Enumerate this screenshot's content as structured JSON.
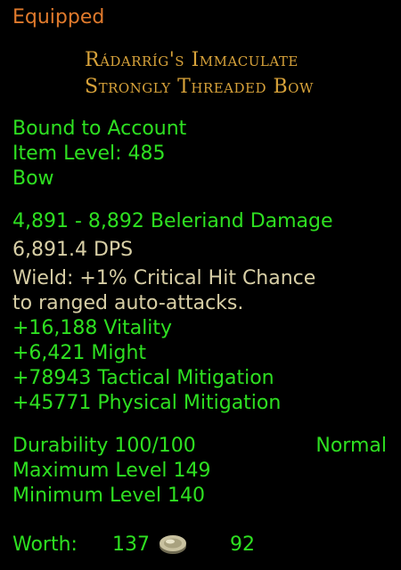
{
  "header": {
    "equipped": "Equipped"
  },
  "item": {
    "name_line1": "Rádarríg's Immaculate",
    "name_line2": "Strongly Threaded Bow",
    "binding": "Bound to Account",
    "item_level": "Item Level: 485",
    "type": "Bow",
    "damage": "4,891 - 8,892 Beleriand Damage",
    "dps": "6,891.4 DPS",
    "wield_line1": "Wield: +1% Critical Hit Chance",
    "wield_line2": "to ranged auto-attacks.",
    "stats": [
      "+16,188 Vitality",
      "+6,421 Might",
      "+78943 Tactical Mitigation",
      "+45771 Physical Mitigation"
    ],
    "durability": "Durability 100/100",
    "quality": "Normal",
    "max_level": "Maximum Level 149",
    "min_level": "Minimum Level 140",
    "worth_label": "Worth:",
    "worth_gold": "137",
    "worth_silver": "92",
    "coin_icon": "silver-coin-icon"
  }
}
